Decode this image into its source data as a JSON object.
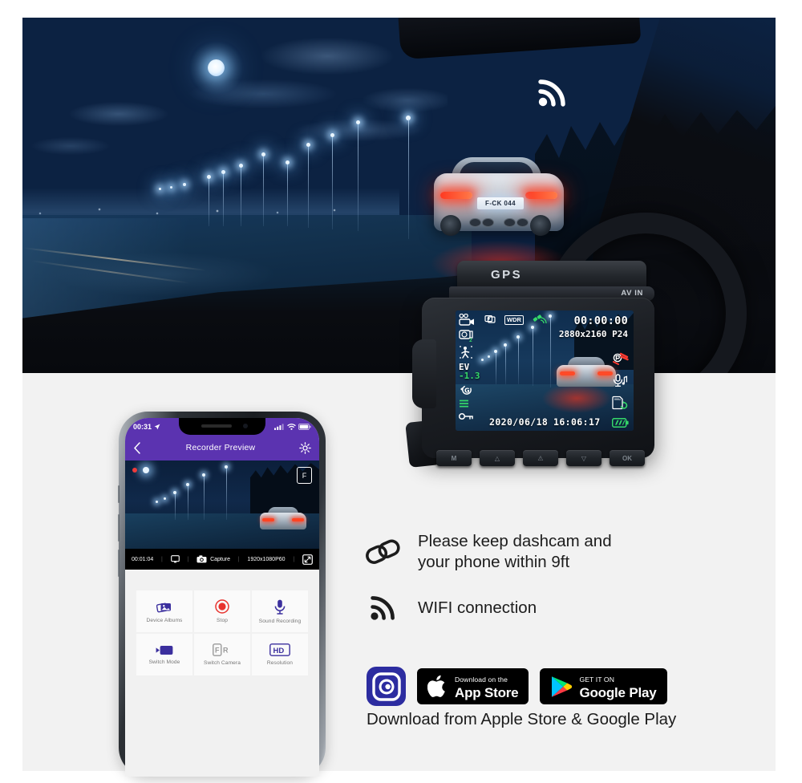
{
  "hero": {
    "wifi_icon": "wifi-signal-icon",
    "scene_description": "night-highway-with-car"
  },
  "dashcam": {
    "brand_label": "GPS",
    "av_in_label": "AV IN",
    "buttons": [
      {
        "name": "mode-button",
        "label": "M"
      },
      {
        "name": "up-button",
        "label": "△"
      },
      {
        "name": "emergency-button",
        "label": "⚠"
      },
      {
        "name": "down-button",
        "label": "▽"
      },
      {
        "name": "ok-button",
        "label": "OK"
      }
    ],
    "osd": {
      "recording_time": "00:00:00",
      "resolution": "2880x2160 P24",
      "date": "2020/06/18",
      "clock": "16:06:17",
      "wdr_label": "WDR",
      "ev_label": "EV",
      "ev_value": "-1.3",
      "loop_value": "2",
      "gsensor_label": "G",
      "left_icons": [
        "video-record-icon",
        "loop-recording-icon",
        "motion-detection-icon",
        "ev-compensation-icon",
        "g-sensor-icon",
        "menu-icon",
        "key-lock-icon"
      ],
      "top_icons": [
        "photo-mode-icon",
        "wdr-icon",
        "gps-satellite-icon"
      ],
      "right_icons": [
        "parking-monitor-icon",
        "microphone-icon",
        "sd-card-loop-icon",
        "battery-icon"
      ]
    }
  },
  "phone": {
    "status_bar": {
      "time": "00:31",
      "location_icon": "location-arrow-icon",
      "signal_icon": "cellular-signal-icon",
      "wifi_icon": "wifi-icon",
      "battery_icon": "battery-icon"
    },
    "app_bar": {
      "back_icon": "chevron-left-icon",
      "title": "Recorder Preview",
      "settings_icon": "gear-icon"
    },
    "preview": {
      "front_badge": "F",
      "rec_indicator": "recording-dot-icon"
    },
    "preview_bar": {
      "elapsed": "00:01:04",
      "screen_icon": "screen-icon",
      "capture_icon": "camera-icon",
      "capture_label": "Capture",
      "resolution": "1920x1080P60",
      "fullscreen_icon": "expand-icon"
    },
    "buttons": [
      {
        "name": "device-albums-button",
        "label": "Device Albums",
        "icon": "albums-icon"
      },
      {
        "name": "stop-button",
        "label": "Stop",
        "icon": "record-stop-icon"
      },
      {
        "name": "sound-recording-button",
        "label": "Sound Recording",
        "icon": "microphone-icon"
      },
      {
        "name": "switch-mode-button",
        "label": "Switch Mode",
        "icon": "video-camera-icon"
      },
      {
        "name": "switch-camera-button",
        "label": "Switch Camera",
        "icon": "front-rear-icon"
      },
      {
        "name": "resolution-button",
        "label": "Resolution",
        "icon": "hd-icon"
      }
    ]
  },
  "features": [
    {
      "icon": "chain-link-icon",
      "line1": "Please keep dashcam and",
      "line2": "your phone within 9ft"
    },
    {
      "icon": "wifi-signal-icon",
      "line1": "WIFI connection",
      "line2": ""
    }
  ],
  "stores": {
    "app_icon": "dashcam-app-icon",
    "apple": {
      "small": "Download on the",
      "large": "App Store",
      "icon": "apple-logo-icon"
    },
    "google": {
      "small": "GET IT ON",
      "large": "Google Play",
      "icon": "google-play-icon"
    },
    "caption": "Download from Apple Store & Google Play"
  },
  "colors": {
    "app_accent": "#5b33b0",
    "panel_bg": "#f2f2f2",
    "text": "#1c1c1c",
    "record_red": "#ef3b3b",
    "osd_green": "#35d96a",
    "app_icon_blue": "#2c2ca0"
  }
}
